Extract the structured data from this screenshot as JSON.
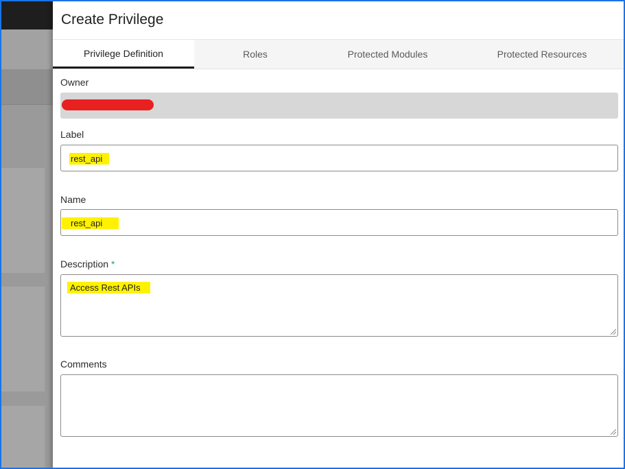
{
  "dialog": {
    "title": "Create Privilege"
  },
  "tabs": [
    {
      "label": "Privilege Definition",
      "active": true
    },
    {
      "label": "Roles",
      "active": false
    },
    {
      "label": "Protected Modules",
      "active": false
    },
    {
      "label": "Protected Resources",
      "active": false
    }
  ],
  "form": {
    "owner": {
      "label": "Owner",
      "value": "",
      "redacted": true
    },
    "label": {
      "label": "Label",
      "value": "rest_api"
    },
    "name": {
      "label": "Name",
      "value": "rest_api"
    },
    "description": {
      "label": "Description",
      "required_marker": "*",
      "value": "Access Rest APIs"
    },
    "comments": {
      "label": "Comments",
      "value": ""
    }
  },
  "colors": {
    "highlight": "#fff200",
    "redaction": "#e82020",
    "required": "#2a9d8f",
    "frame": "#1a73e8"
  }
}
